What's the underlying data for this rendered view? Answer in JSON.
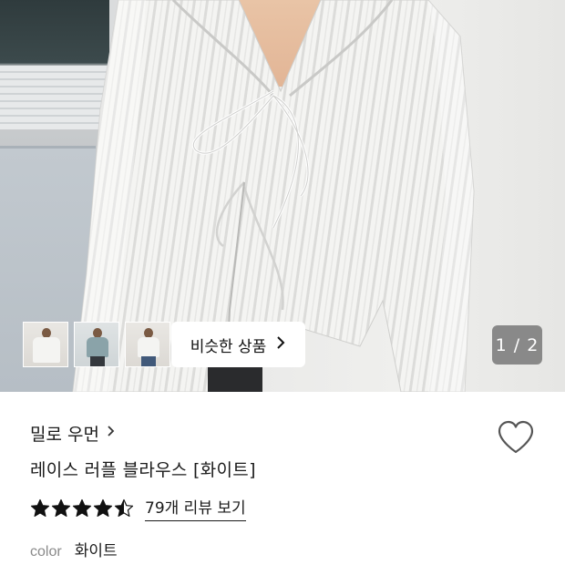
{
  "gallery": {
    "page_indicator": "1 / 2",
    "similar_button_label": "비슷한 상품",
    "thumbnails": [
      "thumb-1",
      "thumb-2",
      "thumb-3"
    ]
  },
  "product": {
    "brand": "밀로 우먼",
    "title": "레이스 러플 블라우스 [화이트]",
    "rating": 4.5,
    "review_link": "79개 리뷰 보기",
    "option_label": "color",
    "option_value": "화이트"
  },
  "colors": {
    "star": "#111111",
    "text": "#1a1a1a",
    "muted": "#8a8a8a"
  },
  "icons": {
    "like": "heart-outline-icon",
    "chevron": "chevron-right-icon",
    "star": "star-icon"
  }
}
